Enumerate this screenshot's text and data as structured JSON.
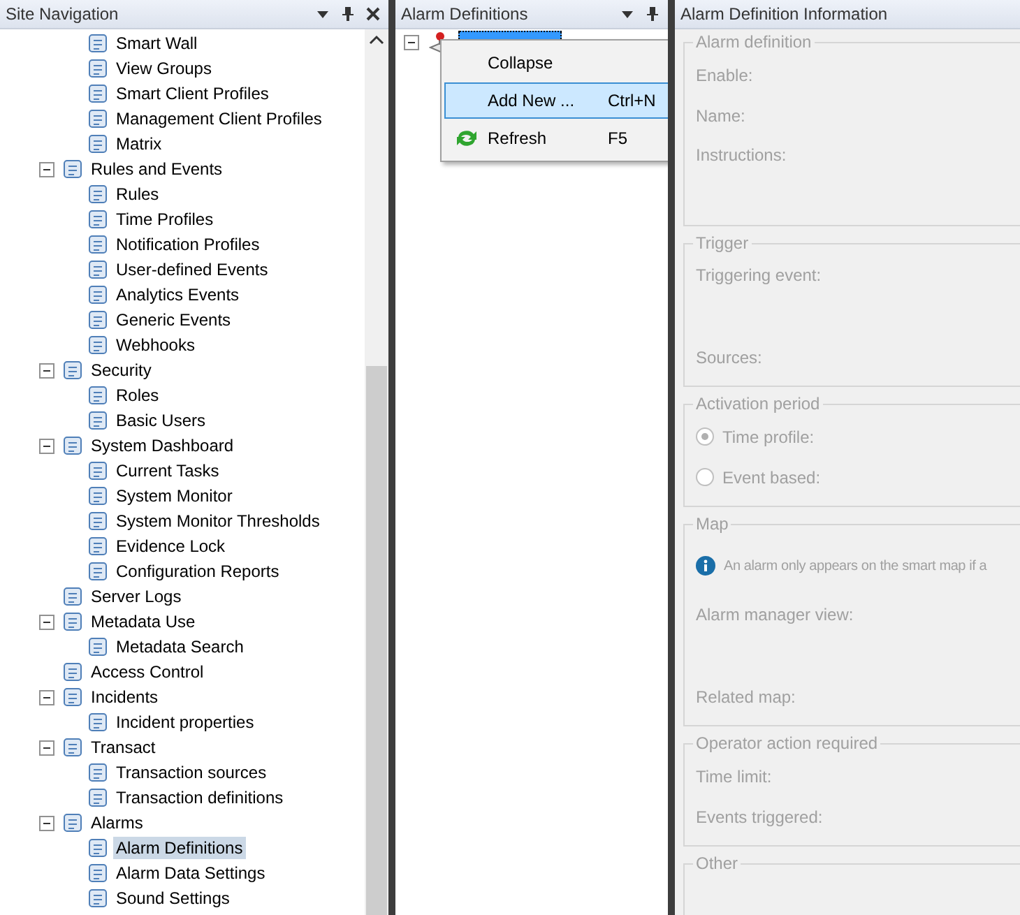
{
  "site_navigation": {
    "title": "Site Navigation",
    "continued_items": [
      {
        "label": "Smart Wall",
        "selected": false
      },
      {
        "label": "View Groups",
        "selected": false
      },
      {
        "label": "Smart Client Profiles",
        "selected": false
      },
      {
        "label": "Management Client Profiles",
        "selected": false
      },
      {
        "label": "Matrix",
        "selected": false
      }
    ],
    "tree": [
      {
        "label": "Rules and Events",
        "expanded": true,
        "selected": false,
        "children": [
          {
            "label": "Rules",
            "selected": false
          },
          {
            "label": "Time Profiles",
            "selected": false
          },
          {
            "label": "Notification Profiles",
            "selected": false
          },
          {
            "label": "User-defined Events",
            "selected": false
          },
          {
            "label": "Analytics Events",
            "selected": false
          },
          {
            "label": "Generic Events",
            "selected": false
          },
          {
            "label": "Webhooks",
            "selected": false
          }
        ]
      },
      {
        "label": "Security",
        "expanded": true,
        "selected": false,
        "children": [
          {
            "label": "Roles",
            "selected": false
          },
          {
            "label": "Basic Users",
            "selected": false
          }
        ]
      },
      {
        "label": "System Dashboard",
        "expanded": true,
        "selected": false,
        "children": [
          {
            "label": "Current Tasks",
            "selected": false
          },
          {
            "label": "System Monitor",
            "selected": false
          },
          {
            "label": "System Monitor Thresholds",
            "selected": false
          },
          {
            "label": "Evidence Lock",
            "selected": false
          },
          {
            "label": "Configuration Reports",
            "selected": false
          }
        ]
      },
      {
        "label": "Server Logs",
        "selected": false
      },
      {
        "label": "Metadata Use",
        "expanded": true,
        "selected": false,
        "children": [
          {
            "label": "Metadata Search",
            "selected": false
          }
        ]
      },
      {
        "label": "Access Control",
        "selected": false
      },
      {
        "label": "Incidents",
        "expanded": true,
        "selected": false,
        "children": [
          {
            "label": "Incident properties",
            "selected": false
          }
        ]
      },
      {
        "label": "Transact",
        "expanded": true,
        "selected": false,
        "children": [
          {
            "label": "Transaction sources",
            "selected": false
          },
          {
            "label": "Transaction definitions",
            "selected": false
          }
        ]
      },
      {
        "label": "Alarms",
        "expanded": true,
        "selected": false,
        "children": [
          {
            "label": "Alarm Definitions",
            "selected": true
          },
          {
            "label": "Alarm Data Settings",
            "selected": false
          },
          {
            "label": "Sound Settings",
            "selected": false
          }
        ]
      }
    ]
  },
  "alarm_definitions": {
    "title": "Alarm Definitions",
    "tree": [
      {
        "expanded": true,
        "selected": true
      }
    ]
  },
  "context_menu": {
    "items": [
      {
        "label": "Collapse",
        "selected": false,
        "has_icon": false
      },
      {
        "label": "Add New ...",
        "shortcut": "Ctrl+N",
        "selected": true,
        "has_icon": false
      },
      {
        "label": "Refresh",
        "shortcut": "F5",
        "selected": false,
        "has_icon": true
      }
    ]
  },
  "details": {
    "title": "Alarm Definition Information",
    "disabled": true,
    "groups": [
      {
        "legend": "Alarm definition",
        "rows": [
          {
            "kind": "field",
            "label": "Enable:"
          },
          {
            "kind": "field",
            "label": "Name:"
          },
          {
            "kind": "tall",
            "label": "Instructions:"
          }
        ]
      },
      {
        "legend": "Trigger",
        "rows": [
          {
            "kind": "tall",
            "label": "Triggering event:"
          },
          {
            "kind": "field",
            "label": "Sources:"
          }
        ]
      },
      {
        "legend": "Activation period",
        "rows": [
          {
            "kind": "radio",
            "label": "Time profile:",
            "selected": true
          },
          {
            "kind": "radio",
            "label": "Event based:",
            "selected": false
          }
        ]
      },
      {
        "legend": "Map",
        "rows": [
          {
            "kind": "info",
            "label": "An alarm only appears on the smart map if a"
          },
          {
            "kind": "tall",
            "label": "Alarm manager view:"
          },
          {
            "kind": "field",
            "label": "Related map:"
          }
        ]
      },
      {
        "legend": "Operator action required",
        "rows": [
          {
            "kind": "field",
            "label": "Time limit:"
          },
          {
            "kind": "field",
            "label": "Events triggered:"
          }
        ]
      },
      {
        "legend": "Other"
      }
    ]
  }
}
